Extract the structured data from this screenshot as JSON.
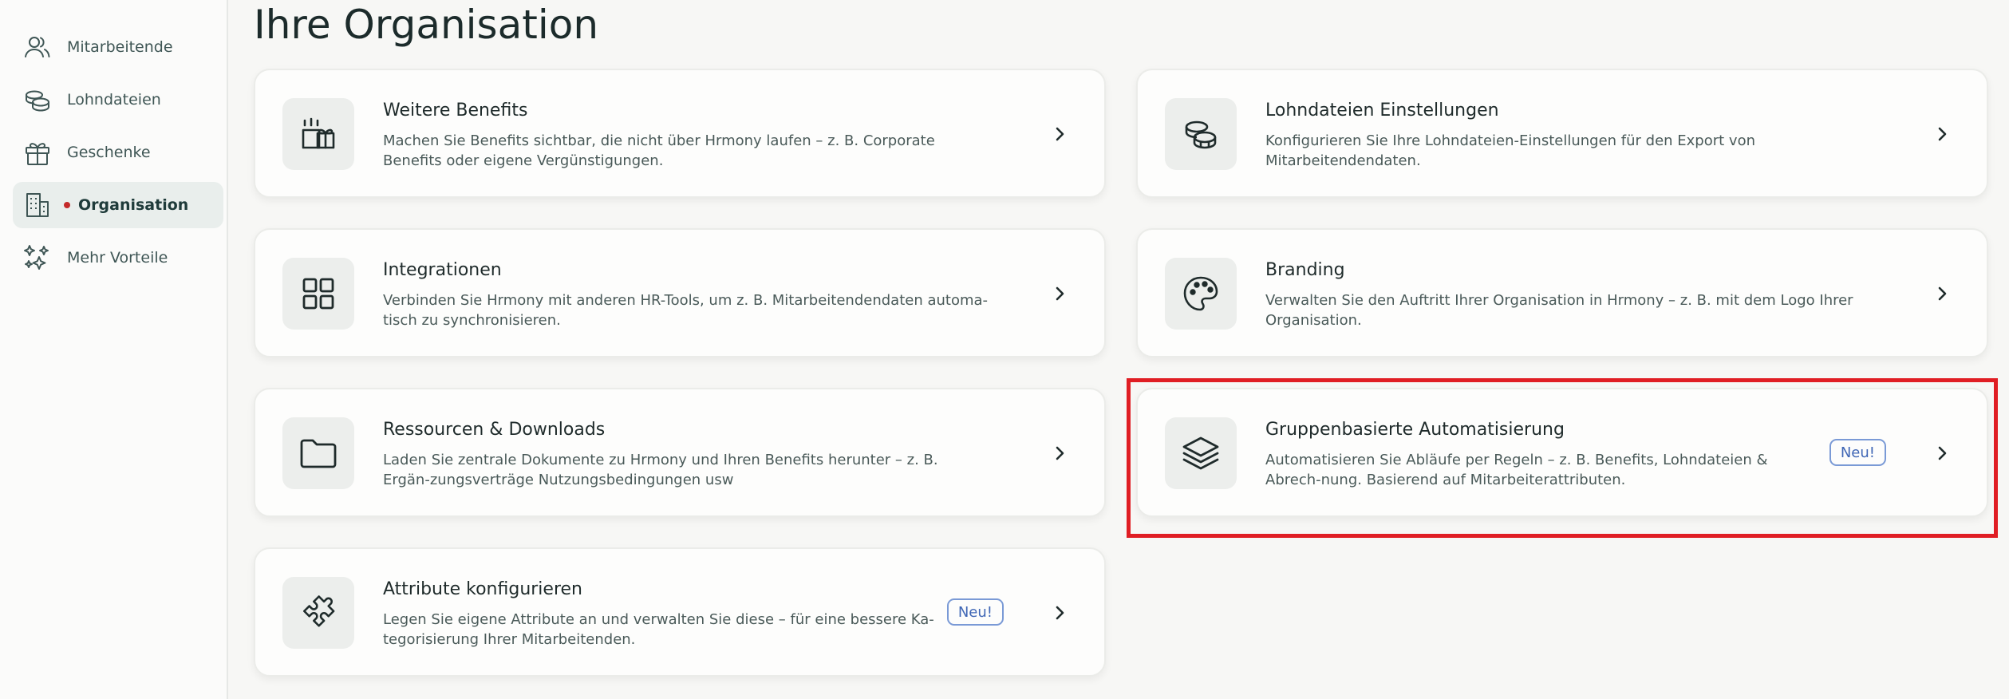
{
  "sidebar": {
    "items": [
      {
        "label": "Mitarbeitende",
        "icon": "users-icon",
        "active": false
      },
      {
        "label": "Lohndateien",
        "icon": "coins-icon",
        "active": false
      },
      {
        "label": "Geschenke",
        "icon": "gift-icon",
        "active": false
      },
      {
        "label": "Organisation",
        "icon": "building-icon",
        "active": true
      },
      {
        "label": "Mehr Vorteile",
        "icon": "sparkles-icon",
        "active": false
      }
    ]
  },
  "page": {
    "title": "Ihre Organisation"
  },
  "cards": [
    {
      "title": "Weitere Benefits",
      "description": "Machen Sie Benefits sichtbar, die nicht über Hrmony laufen – z. B. Corporate Benefits oder eigene Vergünstigungen.",
      "icon": "benefits-gift-icon",
      "badge": ""
    },
    {
      "title": "Lohndateien Einstellungen",
      "description": "Konfigurieren Sie Ihre Lohndateien-Einstellungen für den Export von Mitarbeitendendaten.",
      "icon": "coins-stack-icon",
      "badge": ""
    },
    {
      "title": "Integrationen",
      "description": "Verbinden Sie Hrmony mit anderen HR-Tools, um z. B. Mitarbeitendendaten automa-tisch zu synchronisieren.",
      "icon": "grid-icon",
      "badge": ""
    },
    {
      "title": "Branding",
      "description": "Verwalten Sie den Auftritt Ihrer Organisation in Hrmony – z. B. mit dem Logo Ihrer Organisation.",
      "icon": "palette-icon",
      "badge": ""
    },
    {
      "title": "Ressourcen & Downloads",
      "description": "Laden Sie zentrale Dokumente zu Hrmony und Ihren Benefits herunter – z. B. Ergän-zungsverträge Nutzungsbedingungen usw",
      "icon": "folder-icon",
      "badge": ""
    },
    {
      "title": "Gruppenbasierte Automatisierung",
      "description": "Automatisieren Sie Abläufe per Regeln – z. B. Benefits, Lohndateien & Abrech-nung. Basierend auf Mitarbeiterattributen.",
      "icon": "layers-icon",
      "badge": "Neu!"
    },
    {
      "title": "Attribute konfigurieren",
      "description": "Legen Sie eigene Attribute an und verwalten Sie diese – für eine bessere Ka-tegorisierung Ihrer Mitarbeitenden.",
      "icon": "puzzle-icon",
      "badge": "Neu!"
    }
  ],
  "colors": {
    "accent_red": "#e01e24",
    "badge_blue": "#3f66b5",
    "active_bg": "#e9eeec"
  }
}
